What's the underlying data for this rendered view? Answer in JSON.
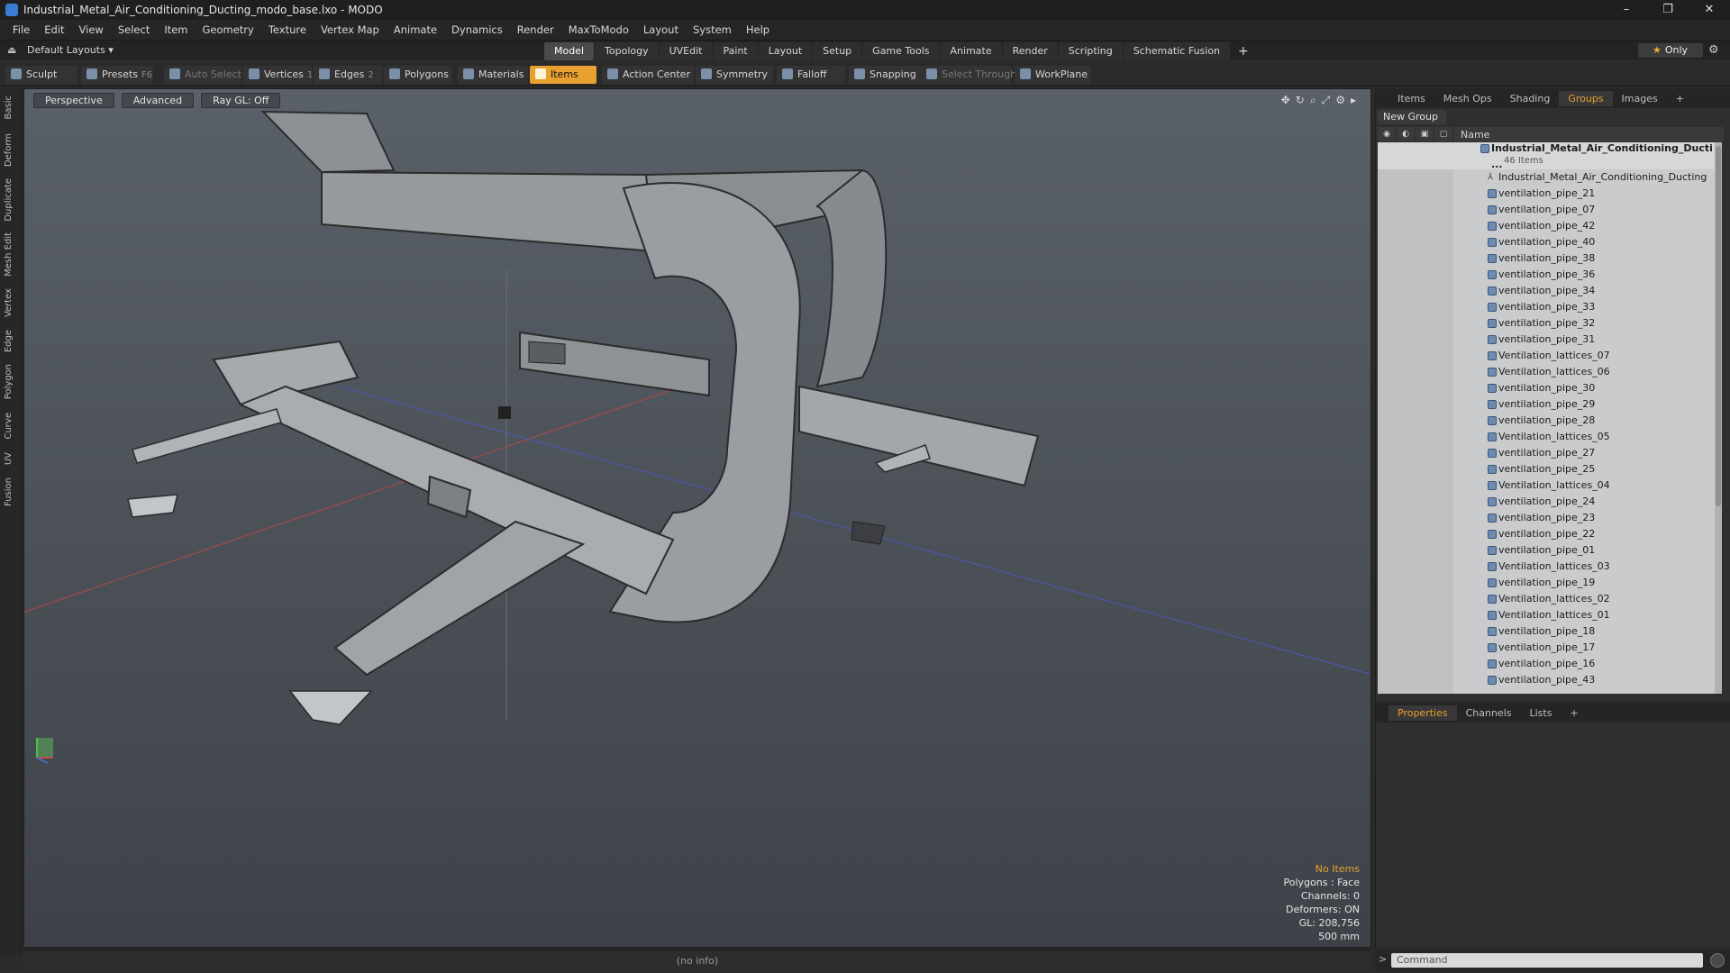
{
  "window": {
    "title": "Industrial_Metal_Air_Conditioning_Ducting_modo_base.lxo - MODO",
    "controls": [
      "–",
      "❐",
      "✕"
    ]
  },
  "menu": [
    "File",
    "Edit",
    "View",
    "Select",
    "Item",
    "Geometry",
    "Texture",
    "Vertex Map",
    "Animate",
    "Dynamics",
    "Render",
    "MaxToModo",
    "Layout",
    "System",
    "Help"
  ],
  "layout_bar": {
    "layouts_label": "Default Layouts ▾",
    "tabs": [
      "Model",
      "Topology",
      "UVEdit",
      "Paint",
      "Layout",
      "Setup",
      "Game Tools",
      "Animate",
      "Render",
      "Scripting",
      "Schematic Fusion"
    ],
    "active_tab": "Model",
    "only_label": "Only"
  },
  "toolbar": {
    "sculpt": "Sculpt",
    "presets": "Presets",
    "presets_hotkey": "F6",
    "auto_select": "Auto Select",
    "vertices": "Vertices",
    "vertices_count": "1",
    "edges": "Edges",
    "edges_count": "2",
    "polygons": "Polygons",
    "materials": "Materials",
    "items": "Items",
    "action_center": "Action Center",
    "symmetry": "Symmetry",
    "falloff": "Falloff",
    "snapping": "Snapping",
    "select_through": "Select Through",
    "workplane": "WorkPlane"
  },
  "left_tabs": [
    "Basic",
    "Deform",
    "Duplicate",
    "Mesh Edit",
    "Vertex",
    "Edge",
    "Polygon",
    "Curve",
    "UV",
    "Fusion"
  ],
  "viewport": {
    "view_mode": "Perspective",
    "shading": "Advanced",
    "raygl": "Ray GL: Off",
    "info": {
      "no_items": "No Items",
      "polygons": "Polygons : Face",
      "channels": "Channels: 0",
      "deformers": "Deformers: ON",
      "gl": "GL: 208,756",
      "unit": "500 mm"
    }
  },
  "status": "(no info)",
  "right_panel": {
    "tabs": [
      "Items",
      "Mesh Ops",
      "Shading",
      "Groups",
      "Images"
    ],
    "active_tab": "Groups",
    "new_group": "New Group",
    "name_col": "Name",
    "group_name": "Industrial_Metal_Air_Conditioning_Ducti ...",
    "group_count": "46 Items",
    "items": [
      "Industrial_Metal_Air_Conditioning_Ducting",
      "ventilation_pipe_21",
      "ventilation_pipe_07",
      "ventilation_pipe_42",
      "ventilation_pipe_40",
      "ventilation_pipe_38",
      "ventilation_pipe_36",
      "ventilation_pipe_34",
      "ventilation_pipe_33",
      "ventilation_pipe_32",
      "ventilation_pipe_31",
      "Ventilation_lattices_07",
      "Ventilation_lattices_06",
      "ventilation_pipe_30",
      "ventilation_pipe_29",
      "ventilation_pipe_28",
      "Ventilation_lattices_05",
      "ventilation_pipe_27",
      "ventilation_pipe_25",
      "Ventilation_lattices_04",
      "ventilation_pipe_24",
      "ventilation_pipe_23",
      "ventilation_pipe_22",
      "ventilation_pipe_01",
      "Ventilation_lattices_03",
      "ventilation_pipe_19",
      "Ventilation_lattices_02",
      "Ventilation_lattices_01",
      "ventilation_pipe_18",
      "ventilation_pipe_17",
      "ventilation_pipe_16",
      "ventilation_pipe_43"
    ]
  },
  "properties_panel": {
    "tabs": [
      "Properties",
      "Channels",
      "Lists"
    ],
    "active_tab": "Properties"
  },
  "command": {
    "placeholder": "Command"
  }
}
